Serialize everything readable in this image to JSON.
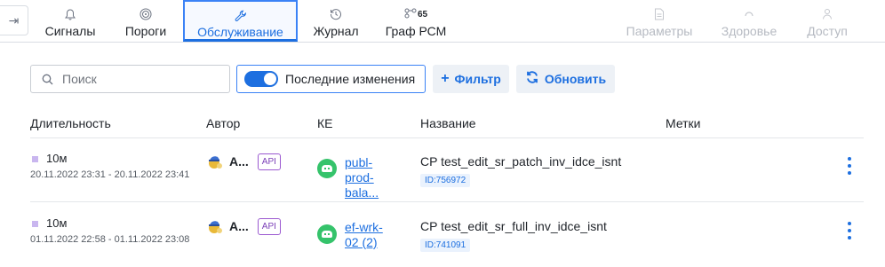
{
  "tabs": [
    {
      "label": "Сигналы",
      "icon": "bell-icon",
      "state": "normal"
    },
    {
      "label": "Пороги",
      "icon": "gauge-icon",
      "state": "normal"
    },
    {
      "label": "Обслуживание",
      "icon": "wrench-icon",
      "state": "active"
    },
    {
      "label": "Журнал",
      "icon": "history-icon",
      "state": "normal"
    },
    {
      "label": "Граф РСМ",
      "icon": "graph-icon",
      "badge": "65",
      "state": "normal"
    },
    {
      "label": "Параметры",
      "icon": "document-icon",
      "state": "disabled"
    },
    {
      "label": "Здоровье",
      "icon": "health-icon",
      "state": "disabled"
    },
    {
      "label": "Доступ",
      "icon": "users-icon",
      "state": "disabled"
    }
  ],
  "toolbar": {
    "search_placeholder": "Поиск",
    "toggle_label": "Последние изменения",
    "toggle_on": true,
    "filter_label": "Фильтр",
    "refresh_label": "Обновить"
  },
  "table": {
    "headers": {
      "duration": "Длительность",
      "author": "Автор",
      "ke": "КЕ",
      "name": "Название",
      "tags": "Метки"
    },
    "rows": [
      {
        "duration": "10м",
        "range": "20.11.2022 23:31 - 20.11.2022 23:41",
        "author": "A...",
        "api": "API",
        "ke": "publ-prod-bala...",
        "name": "CP test_edit_sr_patch_inv_idce_isnt",
        "id": "ID:756972"
      },
      {
        "duration": "10м",
        "range": "01.11.2022 22:58 - 01.11.2022 23:08",
        "author": "A...",
        "api": "API",
        "ke": "ef-wrk-02 (2)",
        "name": "CP test_edit_sr_full_inv_idce_isnt",
        "id": "ID:741091"
      }
    ]
  },
  "colors": {
    "accent": "#1d6fe0",
    "ke_icon": "#35c36b",
    "api_badge": "#9b59d0"
  }
}
